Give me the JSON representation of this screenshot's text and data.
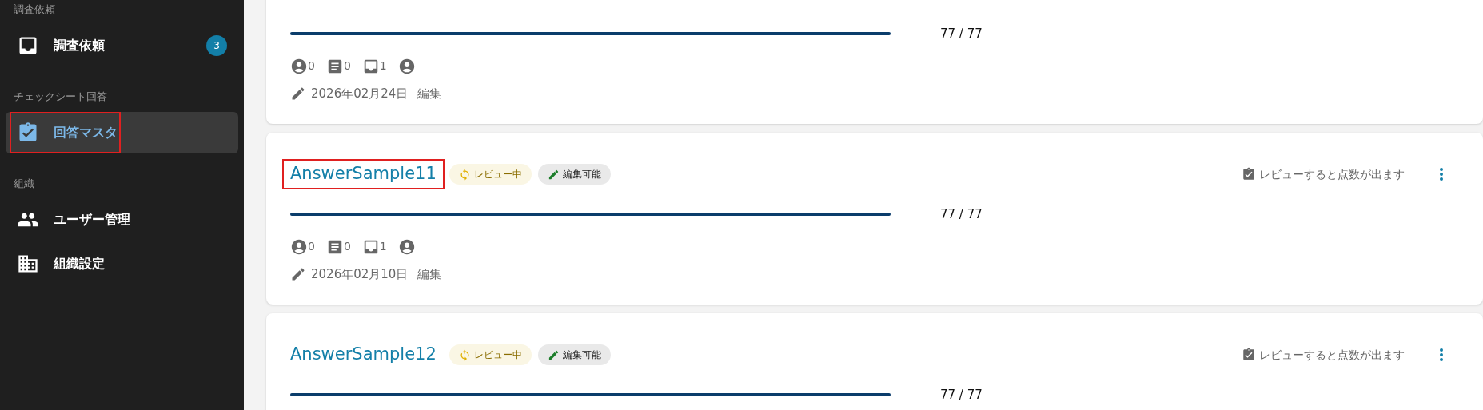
{
  "sidebar": {
    "sections": [
      {
        "label": "調査依頼",
        "items": [
          {
            "kind": "inbox",
            "label": "調査依頼",
            "count": "3",
            "selected": false,
            "highlighted": false
          }
        ]
      },
      {
        "label": "チェックシート回答",
        "items": [
          {
            "kind": "clipboard",
            "label": "回答マスタ",
            "selected": true,
            "highlighted": true
          }
        ]
      },
      {
        "label": "組織",
        "items": [
          {
            "kind": "people",
            "label": "ユーザー管理",
            "selected": false,
            "highlighted": false
          },
          {
            "kind": "building",
            "label": "組織設定",
            "selected": false,
            "highlighted": false
          }
        ]
      }
    ]
  },
  "cards": [
    {
      "level": 1,
      "score": "77 / 77",
      "stats": [
        {
          "kind": "user",
          "count": "0"
        },
        {
          "kind": "article",
          "count": "0"
        },
        {
          "kind": "inbox",
          "count": "1"
        },
        {
          "kind": "user"
        }
      ],
      "date": "2026年02月24日",
      "action": "編集"
    },
    {
      "title": "AnswerSample11",
      "highlighted": true,
      "badges": [
        {
          "kind": "review",
          "label": "レビュー中"
        },
        {
          "kind": "editable",
          "label": "編集可能"
        }
      ],
      "note": "レビューすると点数が出ます",
      "level": 1,
      "score": "77 / 77",
      "stats": [
        {
          "kind": "user",
          "count": "0"
        },
        {
          "kind": "article",
          "count": "0"
        },
        {
          "kind": "inbox",
          "count": "1"
        },
        {
          "kind": "user"
        }
      ],
      "date": "2026年02月10日",
      "action": "編集"
    },
    {
      "title": "AnswerSample12",
      "highlighted": false,
      "badges": [
        {
          "kind": "review",
          "label": "レビュー中"
        },
        {
          "kind": "editable",
          "label": "編集可能"
        }
      ],
      "note": "レビューすると点数が出ます",
      "level": 1,
      "score": "77 / 77"
    }
  ]
}
